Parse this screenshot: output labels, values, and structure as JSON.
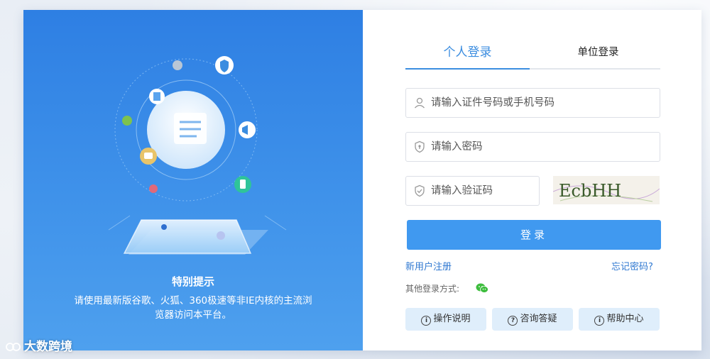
{
  "notice": {
    "title": "特别提示",
    "text": "请使用最新版谷歌、火狐、360极速等非IE内核的主流浏览器访问本平台。"
  },
  "tabs": [
    {
      "label": "个人登录",
      "active": true
    },
    {
      "label": "单位登录",
      "active": false
    }
  ],
  "form": {
    "id_placeholder": "请输入证件号码或手机号码",
    "password_placeholder": "请输入密码",
    "captcha_placeholder": "请输入验证码",
    "captcha_text": "EcbHH",
    "submit_label": "登录"
  },
  "links": {
    "register": "新用户注册",
    "forgot": "忘记密码?"
  },
  "other_login": {
    "label": "其他登录方式:",
    "icon": "wechat-icon"
  },
  "help_buttons": [
    {
      "label": "操作说明",
      "icon": "info-icon"
    },
    {
      "label": "咨询答疑",
      "icon": "question-icon"
    },
    {
      "label": "帮助中心",
      "icon": "info-icon"
    }
  ],
  "watermark": "大数跨境",
  "colors": {
    "accent": "#3b8de0",
    "button": "#4099f0",
    "panel_blue": "#3f92ea",
    "help_bg": "#dfeefb"
  }
}
